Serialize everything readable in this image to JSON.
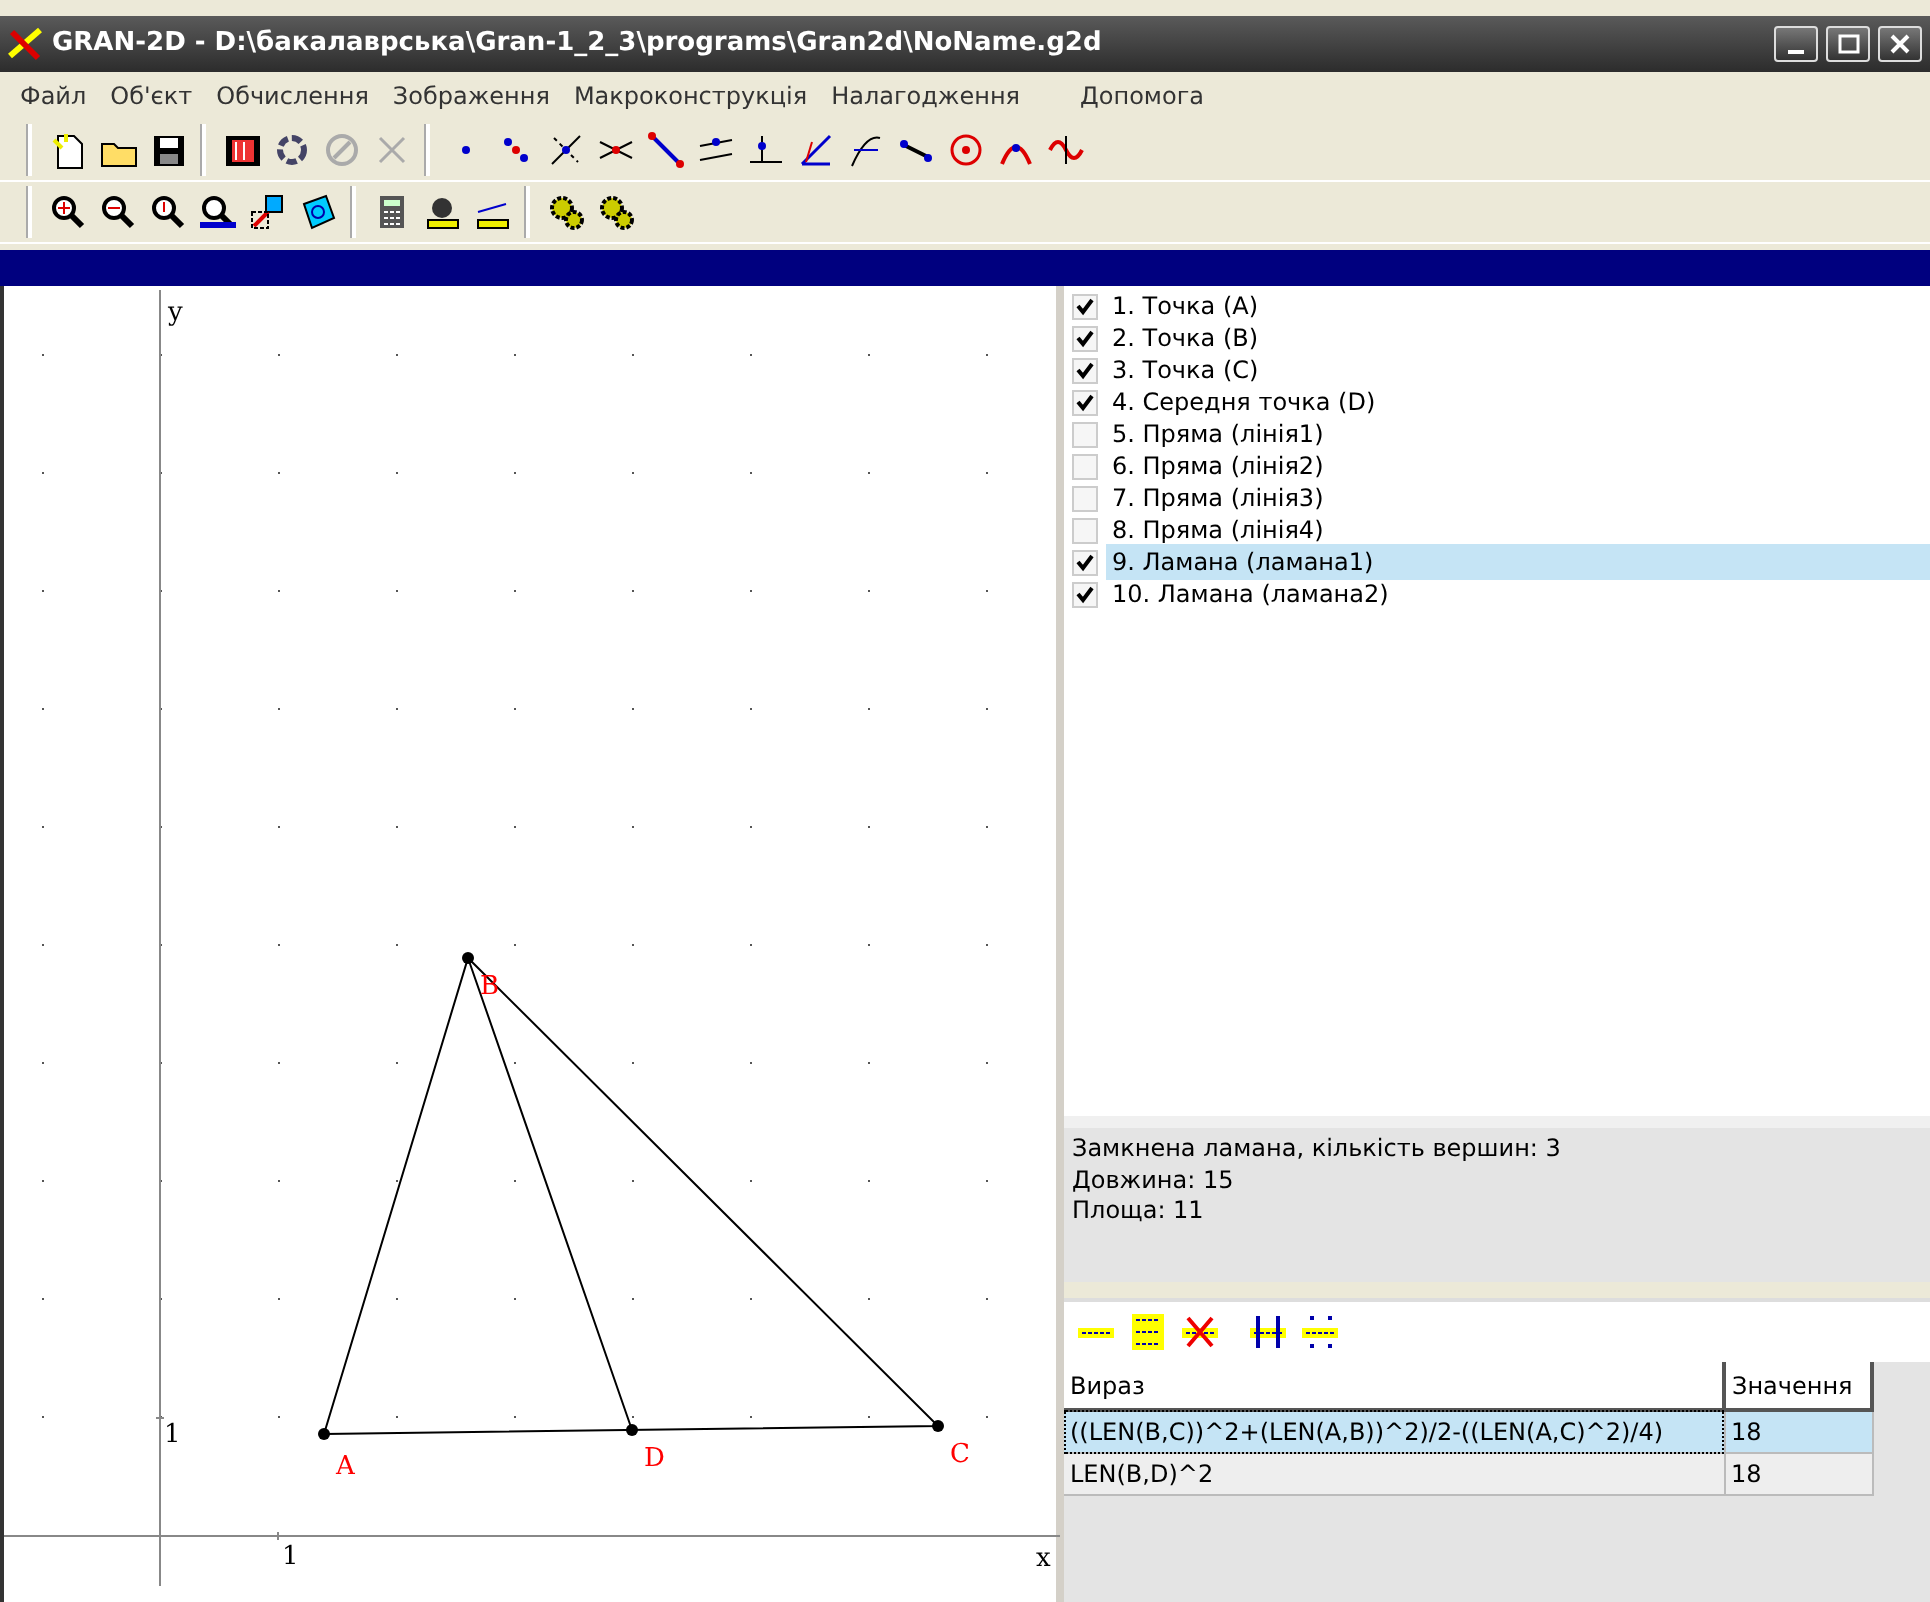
{
  "window": {
    "title": "GRAN-2D - D:\\бакалаврська\\Gran-1_2_3\\programs\\Gran2d\\NoName.g2d"
  },
  "menu": [
    "Файл",
    "Об'єкт",
    "Обчислення",
    "Зображення",
    "Макроконструкція",
    "Налагодження",
    "Допомога"
  ],
  "canvas": {
    "x_axis_label": "x",
    "y_axis_label": "y",
    "x_tick_label": "1",
    "y_tick_label": "1",
    "points": [
      {
        "label": "A"
      },
      {
        "label": "B"
      },
      {
        "label": "D"
      },
      {
        "label": "C"
      }
    ]
  },
  "objects": [
    {
      "label": "1. Точка (A)",
      "checked": true,
      "selected": false
    },
    {
      "label": "2. Точка (B)",
      "checked": true,
      "selected": false
    },
    {
      "label": "3. Точка (C)",
      "checked": true,
      "selected": false
    },
    {
      "label": "4. Середня точка (D)",
      "checked": true,
      "selected": false
    },
    {
      "label": "5. Пряма (лінія1)",
      "checked": false,
      "selected": false
    },
    {
      "label": "6. Пряма (лінія2)",
      "checked": false,
      "selected": false
    },
    {
      "label": "7. Пряма (лінія3)",
      "checked": false,
      "selected": false
    },
    {
      "label": "8. Пряма (лінія4)",
      "checked": false,
      "selected": false
    },
    {
      "label": "9. Ламана (ламана1)",
      "checked": true,
      "selected": true
    },
    {
      "label": "10. Ламана (ламана2)",
      "checked": true,
      "selected": false
    }
  ],
  "info": [
    "Замкнена ламана, кількість вершин: 3",
    "Довжина: 15",
    "Площа: 11"
  ],
  "table": {
    "columns": [
      "Вираз",
      "Значення"
    ],
    "rows": [
      {
        "cells": [
          "((LEN(B,C))^2+(LEN(A,B))^2)/2-((LEN(A,C)^2)/4)",
          "18"
        ],
        "selected": true
      },
      {
        "cells": [
          "LEN(B,D)^2",
          "18"
        ],
        "selected": false
      }
    ]
  }
}
